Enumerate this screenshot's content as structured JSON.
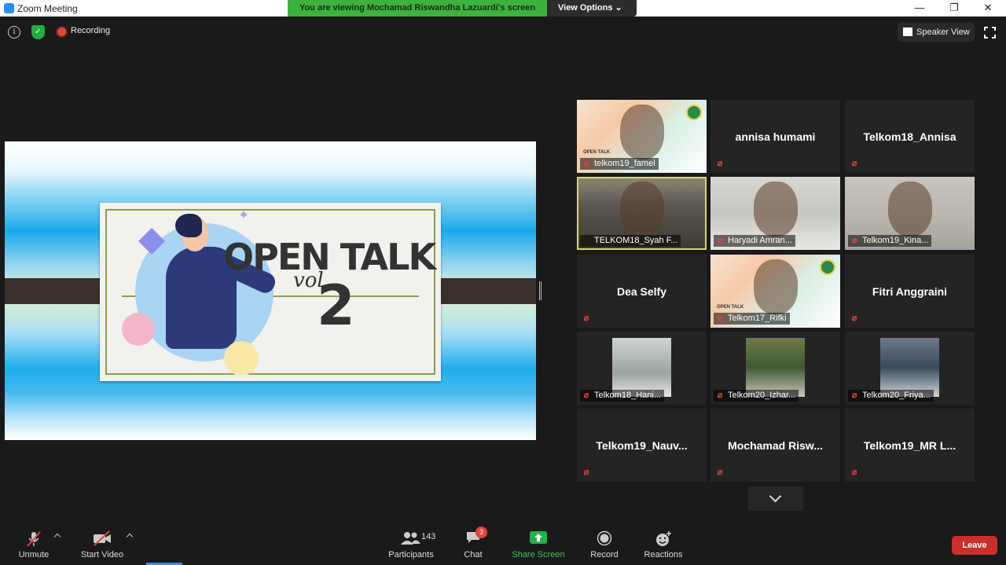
{
  "window": {
    "title": "Zoom Meeting",
    "minimize": "—",
    "restore": "❐",
    "close": "✕"
  },
  "share_banner": {
    "viewing_text": "You are viewing Mochamad Riswandha Lazuardi's screen",
    "view_options": "View Options ⌄"
  },
  "topbar": {
    "info": "i",
    "recording": "Recording",
    "speaker_view": "Speaker View"
  },
  "slide": {
    "title": "OPEN TALK",
    "vol": "vol",
    "number": "2"
  },
  "gallery": [
    {
      "name": "telkom19_famel",
      "video": true
    },
    {
      "name": "annisa humami",
      "video": false
    },
    {
      "name": "Telkom18_Annisa",
      "video": false
    },
    {
      "name": "TELKOM18_Syah F...",
      "video": true,
      "active": true
    },
    {
      "name": "Haryadi Amran...",
      "video": true
    },
    {
      "name": "Telkom19_Kina...",
      "video": true
    },
    {
      "name": "Dea Selfy",
      "video": false
    },
    {
      "name": "Telkom17_Rifki",
      "video": true
    },
    {
      "name": "Fitri Anggraini",
      "video": false
    },
    {
      "name": "Telkom18_Hani...",
      "video": true
    },
    {
      "name": "Telkom20_Izhar...",
      "video": true
    },
    {
      "name": "Telkom20_Friya...",
      "video": true
    },
    {
      "name": "Telkom19_Nauv...",
      "video": false
    },
    {
      "name": "Mochamad  Risw...",
      "video": false
    },
    {
      "name": "Telkom19_MR  L...",
      "video": false
    }
  ],
  "thumb_logo": {
    "open_talk": "OPEN TALK"
  },
  "toolbar": {
    "unmute": "Unmute",
    "start_video": "Start Video",
    "participants": "Participants",
    "participants_count": "143",
    "chat": "Chat",
    "chat_badge": "3",
    "share_screen": "Share Screen",
    "record": "Record",
    "reactions": "Reactions",
    "leave": "Leave"
  },
  "colors": {
    "share_green": "#3cb23c",
    "active_speaker": "#d8e047",
    "leave_red": "#c9302c",
    "accent_blue": "#2d8cff"
  }
}
